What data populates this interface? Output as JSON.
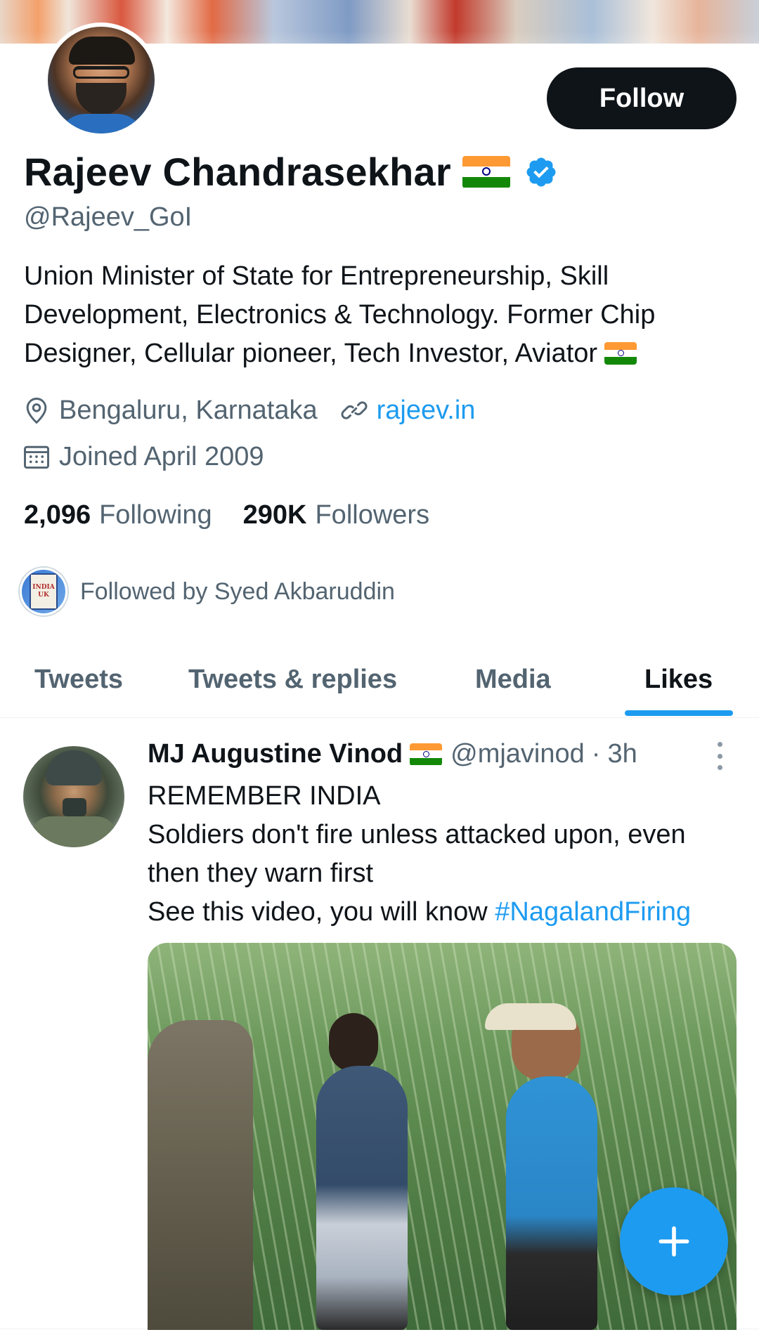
{
  "profile": {
    "name": "Rajeev Chandrasekhar",
    "handle": "@Rajeev_GoI",
    "bio": "Union Minister of State for Entrepreneurship, Skill Development, Electronics & Technology. Former Chip Designer, Cellular pioneer, Tech Investor, Aviator",
    "location": "Bengaluru, Karnataka",
    "website": "rajeev.in",
    "joined": "Joined April 2009",
    "following_count": "2,096",
    "following_label": "Following",
    "followers_count": "290K",
    "followers_label": "Followers",
    "followed_by": "Followed by Syed Akbaruddin",
    "follow_button": "Follow",
    "verified": true
  },
  "tabs": [
    {
      "label": "Tweets",
      "active": false
    },
    {
      "label": "Tweets & replies",
      "active": false
    },
    {
      "label": "Media",
      "active": false
    },
    {
      "label": "Likes",
      "active": true
    }
  ],
  "tweet": {
    "author_name": "MJ Augustine Vinod",
    "author_handle": "@mjavinod",
    "separator": "·",
    "time": "3h",
    "line1": "REMEMBER INDIA",
    "line2": "Soldiers don't fire unless attacked upon, even then they warn first",
    "line3_prefix": "See this video, you will know ",
    "hashtag": "#NagalandFiring"
  },
  "mini_avatar_text": [
    "INDIA",
    "UK"
  ],
  "colors": {
    "accent": "#1d9bf0",
    "text_primary": "#0f1419",
    "text_secondary": "#536471",
    "follow_bg": "#0f1419"
  },
  "icons": [
    "location-icon",
    "link-icon",
    "calendar-icon",
    "verified-badge-icon",
    "india-flag-icon",
    "more-options-icon",
    "compose-plus-icon"
  ]
}
